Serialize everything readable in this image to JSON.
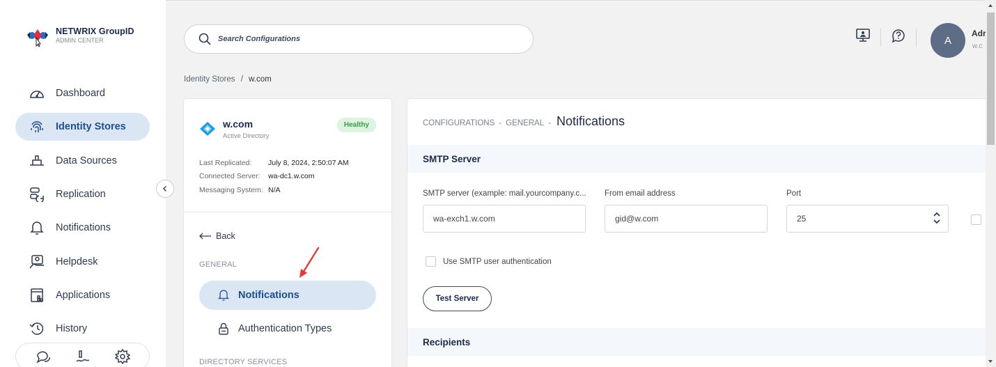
{
  "brand": {
    "name": "NETWRIX GroupID",
    "subtitle": "ADMIN CENTER"
  },
  "sidebar": {
    "items": [
      {
        "label": "Dashboard",
        "icon": "dashboard-gauge-icon",
        "active": false
      },
      {
        "label": "Identity Stores",
        "icon": "fingerprint-icon",
        "active": true
      },
      {
        "label": "Data Sources",
        "icon": "data-source-icon",
        "active": false
      },
      {
        "label": "Replication",
        "icon": "replication-icon",
        "active": false
      },
      {
        "label": "Notifications",
        "icon": "bell-icon",
        "active": false
      },
      {
        "label": "Helpdesk",
        "icon": "helpdesk-icon",
        "active": false
      },
      {
        "label": "Applications",
        "icon": "applications-icon",
        "active": false
      },
      {
        "label": "History",
        "icon": "history-icon",
        "active": false
      }
    ],
    "bottom_icons": [
      "chat-icon",
      "edit-sign-icon",
      "gear-icon"
    ]
  },
  "search": {
    "placeholder": "Search Configurations"
  },
  "user": {
    "initial": "A",
    "name": "Adr",
    "domain": "w.c"
  },
  "breadcrumb": {
    "root": "Identity Stores",
    "separator": "/",
    "current": "w.com"
  },
  "store": {
    "name": "w.com",
    "type": "Active Directory",
    "status": "Healthy",
    "last_replicated_label": "Last Replicated:",
    "last_replicated_value": "July 8, 2024, 2:50:07 AM",
    "connected_server_label": "Connected Server:",
    "connected_server_value": "wa-dc1.w.com",
    "messaging_system_label": "Messaging System:",
    "messaging_system_value": "N/A",
    "back_label": "Back",
    "general_label": "GENERAL",
    "notifications_label": "Notifications",
    "auth_types_label": "Authentication Types",
    "directory_services_label": "DIRECTORY SERVICES"
  },
  "config": {
    "crumb1": "CONFIGURATIONS",
    "crumb2": "GENERAL",
    "crumb_sep": "-",
    "title": "Notifications",
    "smtp_section": "SMTP Server",
    "smtp_server_label": "SMTP server (example: mail.yourcompany.c...",
    "smtp_server_value": "wa-exch1.w.com",
    "from_email_label": "From email address",
    "from_email_value": "gid@w.com",
    "port_label": "Port",
    "port_value": "25",
    "use_auth_label": "Use SMTP user authentication",
    "test_server_label": "Test Server",
    "recipients_section": "Recipients"
  },
  "colors": {
    "active_bg": "#dbe6f5",
    "active_text": "#1f4e8c",
    "healthy_bg": "#dff3e1",
    "healthy_text": "#3b9b4a",
    "annotation_arrow": "#e53935"
  }
}
